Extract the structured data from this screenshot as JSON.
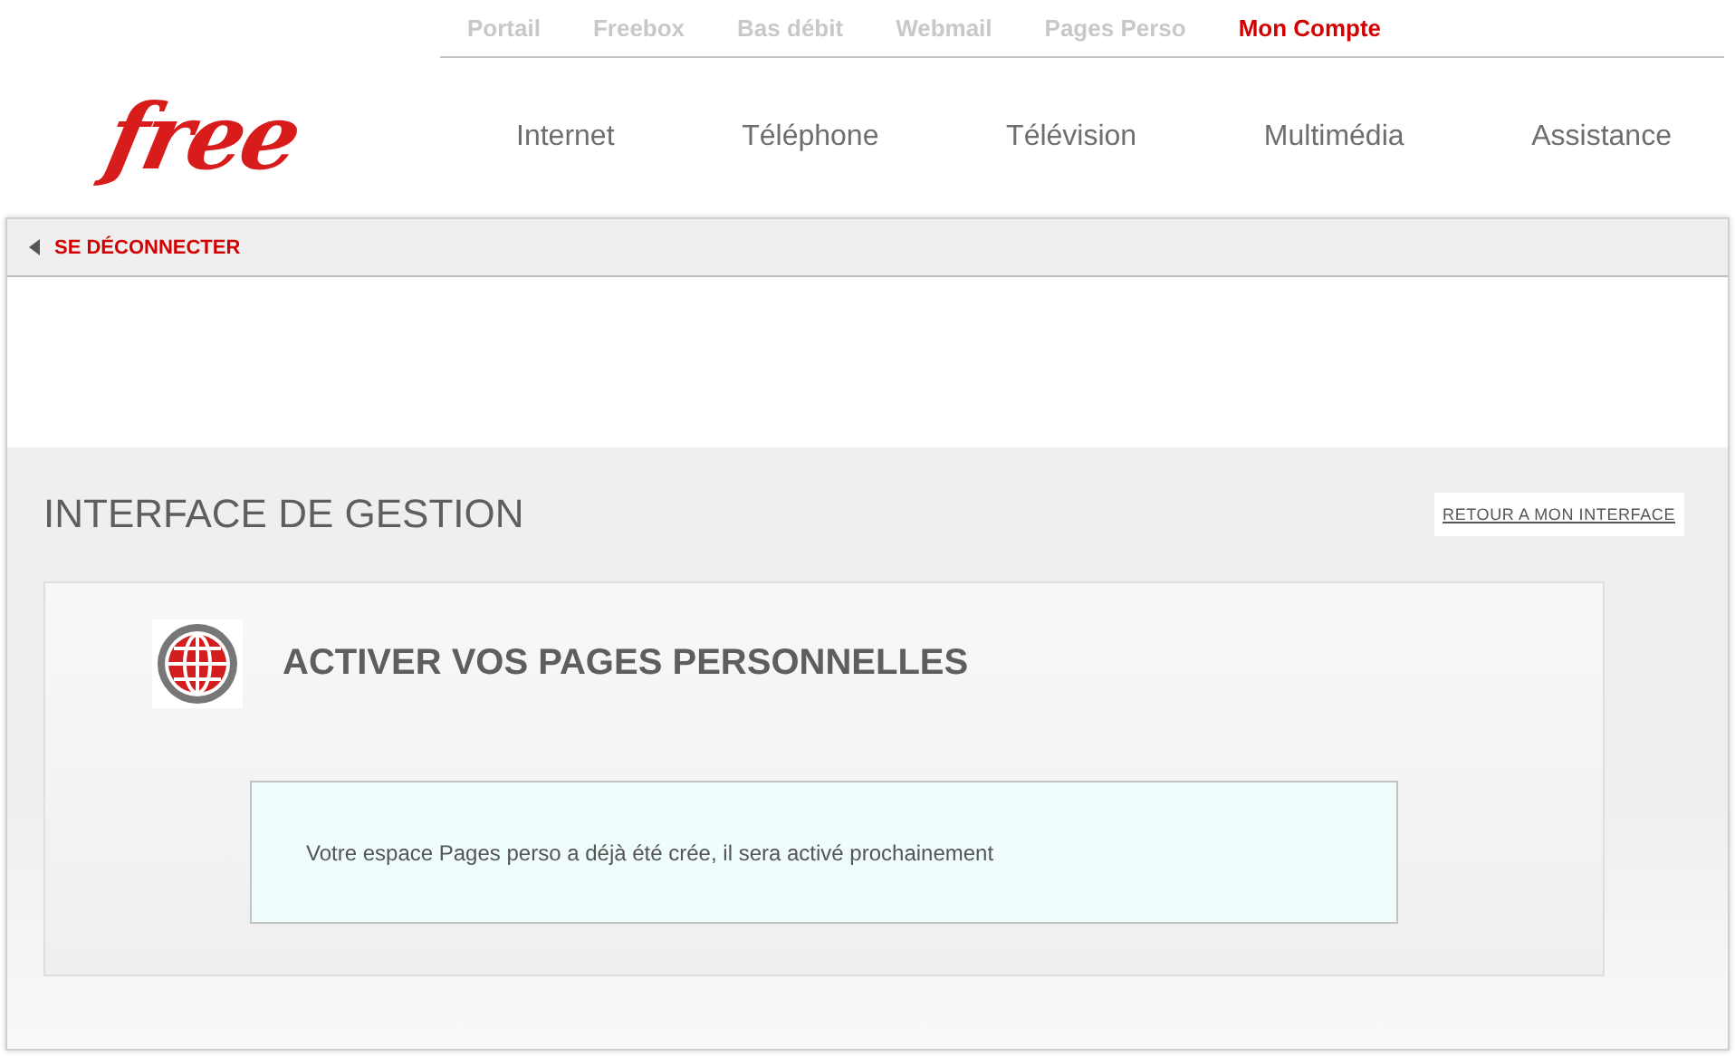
{
  "top_links": [
    {
      "label": "Portail",
      "selected": false
    },
    {
      "label": "Freebox",
      "selected": false
    },
    {
      "label": "Bas débit",
      "selected": false
    },
    {
      "label": "Webmail",
      "selected": false
    },
    {
      "label": "Pages Perso",
      "selected": false
    },
    {
      "label": "Mon Compte",
      "selected": true
    }
  ],
  "logo": "free",
  "main_nav": [
    "Internet",
    "Téléphone",
    "Télévision",
    "Multimédia",
    "Assistance"
  ],
  "logout": "SE DÉCONNECTER",
  "page_title": "INTERFACE DE GESTION",
  "back_link": "RETOUR A MON INTERFACE",
  "card": {
    "heading": "ACTIVER VOS PAGES PERSONNELLES",
    "message": "Votre espace Pages perso a déjà été crée, il sera activé prochainement"
  }
}
